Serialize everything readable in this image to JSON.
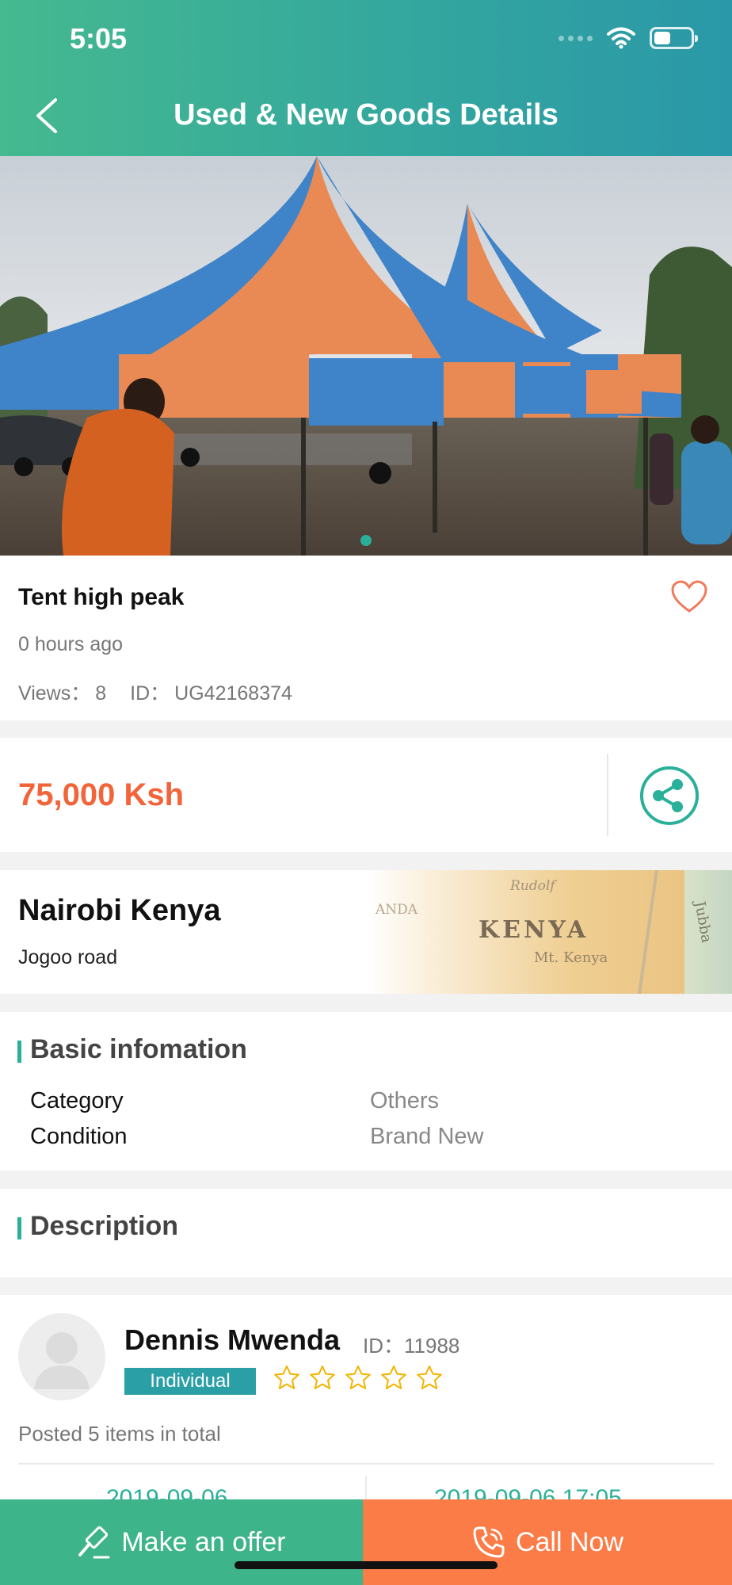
{
  "status_bar": {
    "time": "5:05",
    "battery_level": 0.45
  },
  "header": {
    "title": "Used & New Goods Details"
  },
  "gallery": {
    "page_count": 1,
    "current_page": 1
  },
  "item": {
    "title": "Tent high peak",
    "posted_ago": "0 hours ago",
    "views_label": "Views：",
    "views_value": "8",
    "id_label": "ID：",
    "id_value": "UG42168374",
    "price": "75,000 Ksh"
  },
  "location": {
    "city": "Nairobi Kenya",
    "road": "Jogoo road",
    "map_text": {
      "country": "KENYA",
      "side": "ANDA",
      "top": "Rudolf",
      "mountain": "Mt. Kenya",
      "right": "Jubba"
    }
  },
  "basic_info": {
    "heading": "Basic infomation",
    "rows": [
      {
        "label": "Category",
        "value": "Others"
      },
      {
        "label": "Condition",
        "value": "Brand New"
      }
    ]
  },
  "description": {
    "heading": "Description"
  },
  "seller": {
    "name": "Dennis Mwenda",
    "id_label": "ID：",
    "id_value": "11988",
    "type_badge": "Individual",
    "rating_stars": 0,
    "rating_max": 5,
    "posted_summary": "Posted 5 items in total",
    "date_left": "2019-09-06",
    "date_right": "2019-09-06 17:05"
  },
  "actions": {
    "offer_label": "Make an offer",
    "call_label": "Call Now"
  },
  "colors": {
    "accent": "#2ab09a",
    "price": "#f2643a",
    "call": "#fb7c47",
    "offer": "#3eb48b",
    "heart": "#f07a5c",
    "star": "#f3b400"
  }
}
